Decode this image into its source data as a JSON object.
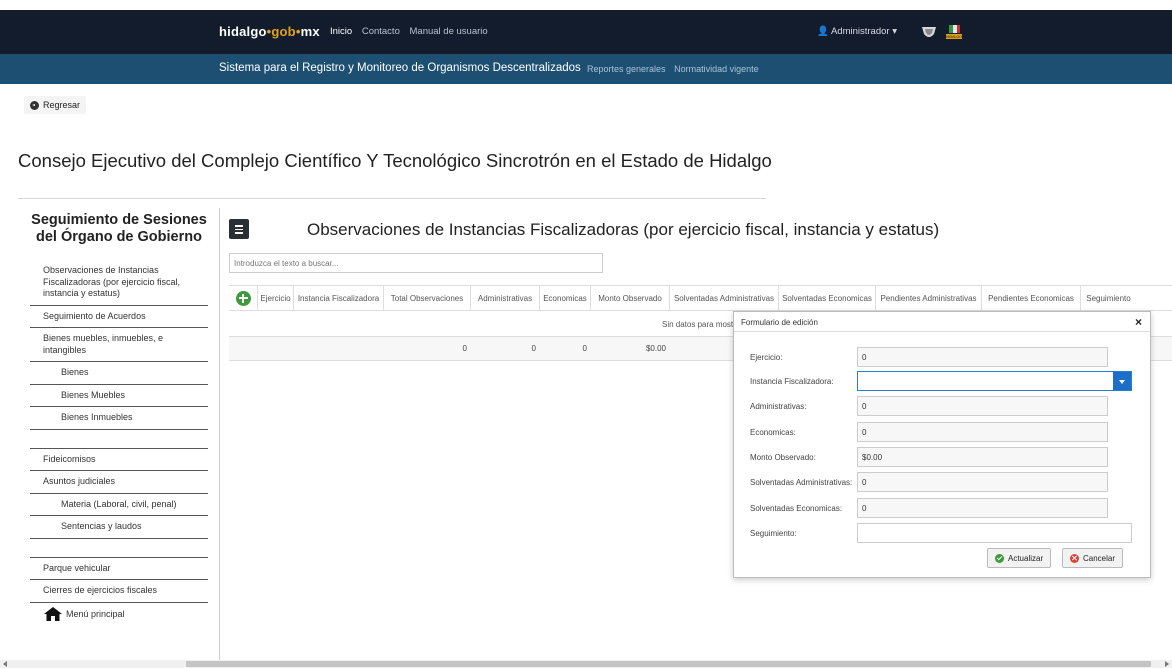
{
  "topbar": {
    "brand_part1": "hidalgo",
    "brand_sep1": "•",
    "brand_part2": "gob",
    "brand_sep2": "•",
    "brand_part3": "mx",
    "nav": [
      "Inicio",
      "Contacto",
      "Manual de usuario"
    ],
    "user": "Administrador",
    "logo2_text": "HIDALGO"
  },
  "subbar": {
    "title": "Sistema para el Registro y Monitoreo de Organismos Descentralizados",
    "links": [
      "Reportes generales",
      "Normatividad vigente"
    ]
  },
  "back_label": "Regresar",
  "org_title": "Consejo Ejecutivo del Complejo Científico Y Tecnológico Sincrotrón en el Estado de Hidalgo",
  "sidebar": {
    "heading": "Seguimiento de Sesiones del Órgano de Gobierno",
    "items": [
      "Observaciones de Instancias Fiscalizadoras (por ejercicio fiscal, instancia y estatus)",
      "Seguimiento de Acuerdos",
      "Bienes muebles, inmuebles, e intangibles",
      "Bienes",
      "Bienes Muebles",
      "Bienes Inmuebles",
      "Fideicomisos",
      "Asuntos judiciales",
      "Materia (Laboral, civil, penal)",
      "Sentencias y laudos",
      "Parque vehicular",
      "Cierres de ejercicios fiscales"
    ],
    "home": "Menú principal"
  },
  "main": {
    "title": "Observaciones de Instancias Fiscalizadoras (por ejercicio fiscal, instancia y estatus)",
    "search_placeholder": "Introduzca el texto a buscar...",
    "columns": [
      "Ejercicio",
      "Instancia Fiscalizadora",
      "Total Observaciones",
      "Administrativas",
      "Economicas",
      "Monto Observado",
      "Solventadas Administrativas",
      "Solventadas Economicas",
      "Pendientes Administrativas",
      "Pendientes Economicas",
      "Seguimiento"
    ],
    "no_data": "Sin datos para most",
    "totals": [
      "0",
      "0",
      "0",
      "$0.00"
    ]
  },
  "modal": {
    "title": "Formulario de edición",
    "close": "×",
    "fields": [
      {
        "label": "Ejercicio:",
        "value": "0"
      },
      {
        "label": "Instancia Fiscalizadora:",
        "value": ""
      },
      {
        "label": "Administrativas:",
        "value": "0"
      },
      {
        "label": "Economicas:",
        "value": "0"
      },
      {
        "label": "Monto Observado:",
        "value": "$0.00"
      },
      {
        "label": "Solventadas Administrativas:",
        "value": "0"
      },
      {
        "label": "Solventadas Economicas:",
        "value": "0"
      },
      {
        "label": "Seguimiento:",
        "value": ""
      }
    ],
    "update_label": "Actualizar",
    "cancel_label": "Cancelar"
  },
  "colors": {
    "topbar": "#121c2c",
    "subbar": "#1d4f72",
    "brand_accent": "#e0a21a",
    "add_button": "#3d9a3d",
    "cancel_icon": "#d0453d",
    "select_focus": "#1b6fc9"
  },
  "icons": [
    "user-icon",
    "caret-down-icon",
    "back-circle-icon",
    "menu-icon",
    "plus-circle-icon",
    "close-icon",
    "check-circle-icon",
    "x-circle-icon",
    "home-icon"
  ]
}
